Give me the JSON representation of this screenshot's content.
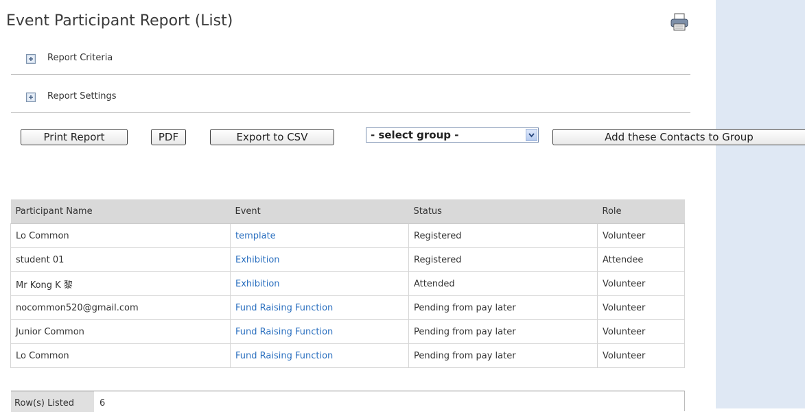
{
  "page": {
    "title": "Event Participant Report (List)"
  },
  "sections": [
    {
      "label": "Report Criteria"
    },
    {
      "label": "Report Settings"
    }
  ],
  "toolbar": {
    "print_label": "Print Report",
    "pdf_label": "PDF",
    "csv_label": "Export to CSV",
    "group_select": "- select group -",
    "add_group_label": "Add these Contacts to Group"
  },
  "table": {
    "columns": [
      "Participant Name",
      "Event",
      "Status",
      "Role"
    ],
    "rows": [
      {
        "name": "Lo Common",
        "event": "template",
        "status": "Registered",
        "role": "Volunteer"
      },
      {
        "name": "student 01",
        "event": "Exhibition",
        "status": "Registered",
        "role": "Attendee"
      },
      {
        "name": "Mr Kong K 黎",
        "event": "Exhibition",
        "status": "Attended",
        "role": "Volunteer"
      },
      {
        "name": "nocommon520@gmail.com",
        "event": "Fund Raising Function",
        "status": "Pending from pay later",
        "role": "Volunteer"
      },
      {
        "name": "Junior Common",
        "event": "Fund Raising Function",
        "status": "Pending from pay later",
        "role": "Volunteer"
      },
      {
        "name": "Lo Common",
        "event": "Fund Raising Function",
        "status": "Pending from pay later",
        "role": "Volunteer"
      }
    ]
  },
  "summary": {
    "label": "Row(s) Listed",
    "value": "6"
  },
  "icons": {
    "print": "printer-icon",
    "expand": "plus-box-icon",
    "dropdown": "chevron-down-icon"
  },
  "colors": {
    "link": "#2a6fbf",
    "header_bg": "#d9d9d9",
    "side_panel": "#dfe8f4"
  }
}
